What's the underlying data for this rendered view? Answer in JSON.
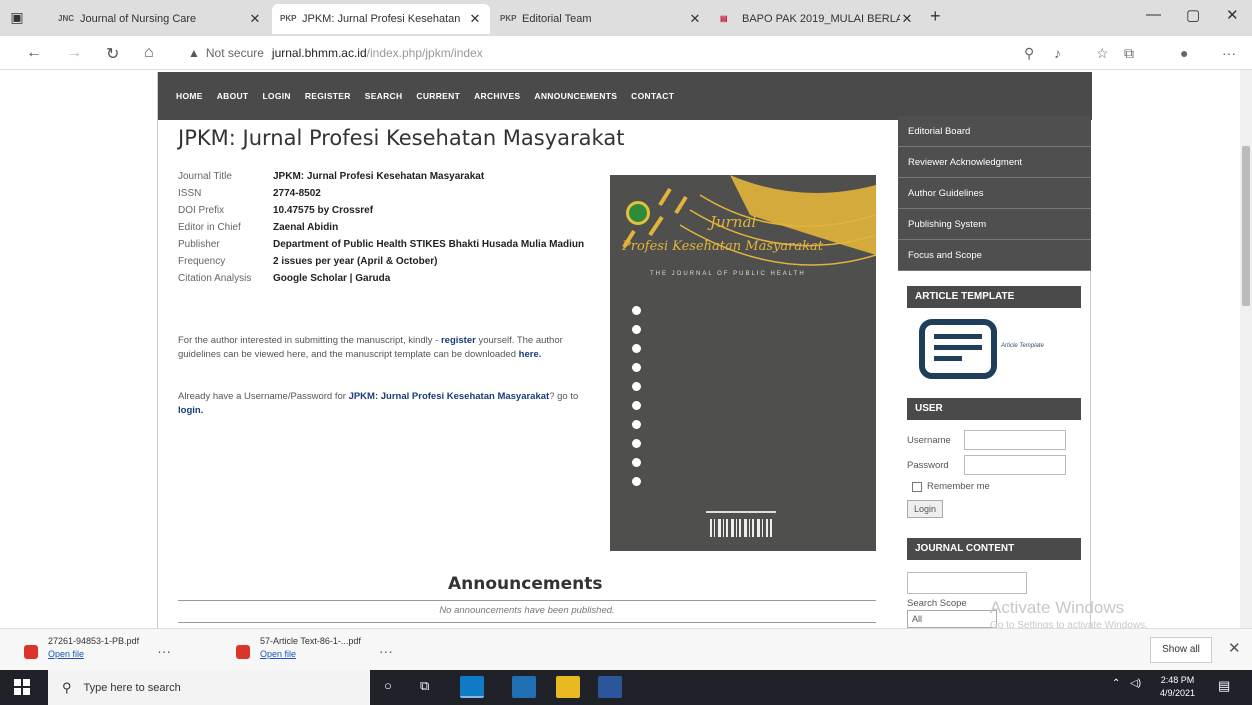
{
  "browser": {
    "tabs": [
      {
        "title": "Journal of Nursing Care",
        "favicon": "JNC"
      },
      {
        "title": "JPKM: Jurnal Profesi Kesehatan",
        "favicon": "PKP"
      },
      {
        "title": "Editorial Team",
        "favicon": "PKP"
      },
      {
        "title": "BAPO PAK 2019_MULAI BERLAKU",
        "favicon": "pdf-icon"
      }
    ],
    "url_warning": "Not secure",
    "url_host": "jurnal.bhmm.ac.id",
    "url_path": "/index.php/jpkm/index"
  },
  "site": {
    "nav": [
      "HOME",
      "ABOUT",
      "LOGIN",
      "REGISTER",
      "SEARCH",
      "CURRENT",
      "ARCHIVES",
      "ANNOUNCEMENTS",
      "CONTACT"
    ],
    "title": "JPKM: Jurnal Profesi Kesehatan Masyarakat",
    "info": [
      {
        "k": "Journal Title",
        "v": "JPKM: Jurnal Profesi Kesehatan Masyarakat"
      },
      {
        "k": "ISSN",
        "v": "2774-8502"
      },
      {
        "k": "DOI Prefix",
        "v": "10.47575 by Crossref"
      },
      {
        "k": "Editor in Chief",
        "v": "Zaenal Abidin"
      },
      {
        "k": "Publisher",
        "v": "Department of Public Health STIKES Bhakti Husada Mulia Madiun"
      },
      {
        "k": "Frequency",
        "v": "2 issues per year (April & October)"
      },
      {
        "k": "Citation Analysis",
        "v": "Google Scholar | Garuda"
      }
    ],
    "para1": {
      "a": "For the author interested in submitting the manuscript, kindly -",
      "b": "register",
      "c": " yourself. The author guidelines can be viewed here, and the manuscript template can be downloaded ",
      "d": "here."
    },
    "para2": {
      "a": "Already have a Username/Password for ",
      "b": "JPKM: Jurnal Profesi Kesehatan Masyarakat",
      "c": "? go to ",
      "d": "login."
    },
    "cover": {
      "jurnal": "Jurnal",
      "title": "Profesi Kesehatan Masyarakat",
      "subtitle": "THE JOURNAL OF PUBLIC HEALTH"
    },
    "announcements_title": "Announcements",
    "announcements_empty": "No announcements have been published.",
    "sidebar_links": [
      "Editorial Board",
      "Reviewer Acknowledgment",
      "Author Guidelines",
      "Publishing System",
      "Focus and Scope"
    ],
    "article_template_head": "ARTICLE TEMPLATE",
    "article_template_label": "Article Template",
    "user_head": "USER",
    "username_label": "Username",
    "password_label": "Password",
    "remember_label": "Remember me",
    "login_button": "Login",
    "journal_content_head": "JOURNAL CONTENT",
    "search_scope_label": "Search Scope",
    "search_scope_value": "All"
  },
  "watermark": {
    "line1": "Activate Windows",
    "line2": "Go to Settings to activate Windows."
  },
  "downloads": [
    {
      "name": "27261-94853-1-PB.pdf",
      "action": "Open file"
    },
    {
      "name": "57-Article Text-86-1-...pdf",
      "action": "Open file"
    }
  ],
  "show_all": "Show all",
  "taskbar": {
    "search_placeholder": "Type here to search",
    "time": "2:48 PM",
    "date": "4/9/2021"
  }
}
